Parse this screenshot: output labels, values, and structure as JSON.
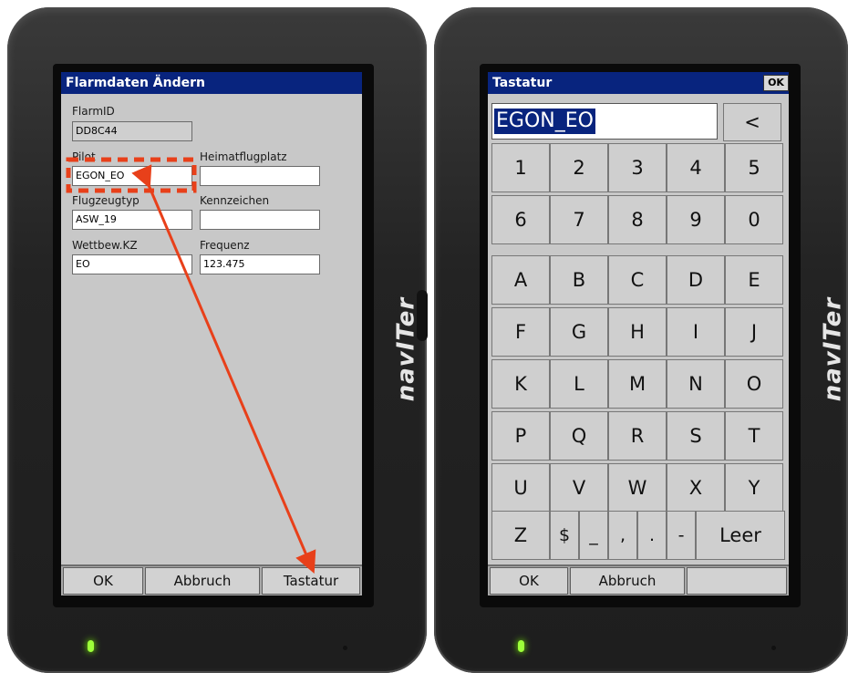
{
  "brand": "navITer",
  "left_screen": {
    "title": "Flarmdaten Ändern",
    "fields": {
      "flarm_id": {
        "label": "FlarmID",
        "value": "DD8C44"
      },
      "pilot": {
        "label": "Pilot",
        "value": "EGON_EO"
      },
      "home_airfield": {
        "label": "Heimatflugplatz",
        "value": ""
      },
      "aircraft_type": {
        "label": "Flugzeugtyp",
        "value": "ASW_19"
      },
      "registration": {
        "label": "Kennzeichen",
        "value": ""
      },
      "competition_id": {
        "label": "Wettbew.KZ",
        "value": "EO"
      },
      "frequency": {
        "label": "Frequenz",
        "value": "123.475"
      }
    },
    "buttons": {
      "ok": "OK",
      "cancel": "Abbruch",
      "keyboard": "Tastatur"
    }
  },
  "right_screen": {
    "title": "Tastatur",
    "ok_corner": "OK",
    "input_value": "EGON_EO",
    "backspace": "<",
    "rows": [
      [
        "1",
        "2",
        "3",
        "4",
        "5"
      ],
      [
        "6",
        "7",
        "8",
        "9",
        "0"
      ],
      [
        "A",
        "B",
        "C",
        "D",
        "E"
      ],
      [
        "F",
        "G",
        "H",
        "I",
        "J"
      ],
      [
        "K",
        "L",
        "M",
        "N",
        "O"
      ],
      [
        "P",
        "Q",
        "R",
        "S",
        "T"
      ],
      [
        "U",
        "V",
        "W",
        "X",
        "Y"
      ]
    ],
    "last_row": {
      "z": "Z",
      "dollar": "$",
      "underscore": "_",
      "comma": ",",
      "dot": ".",
      "dash": "-",
      "space": "Leer"
    },
    "buttons": {
      "ok": "OK",
      "cancel": "Abbruch"
    }
  },
  "annotation_color": "#e8401a"
}
